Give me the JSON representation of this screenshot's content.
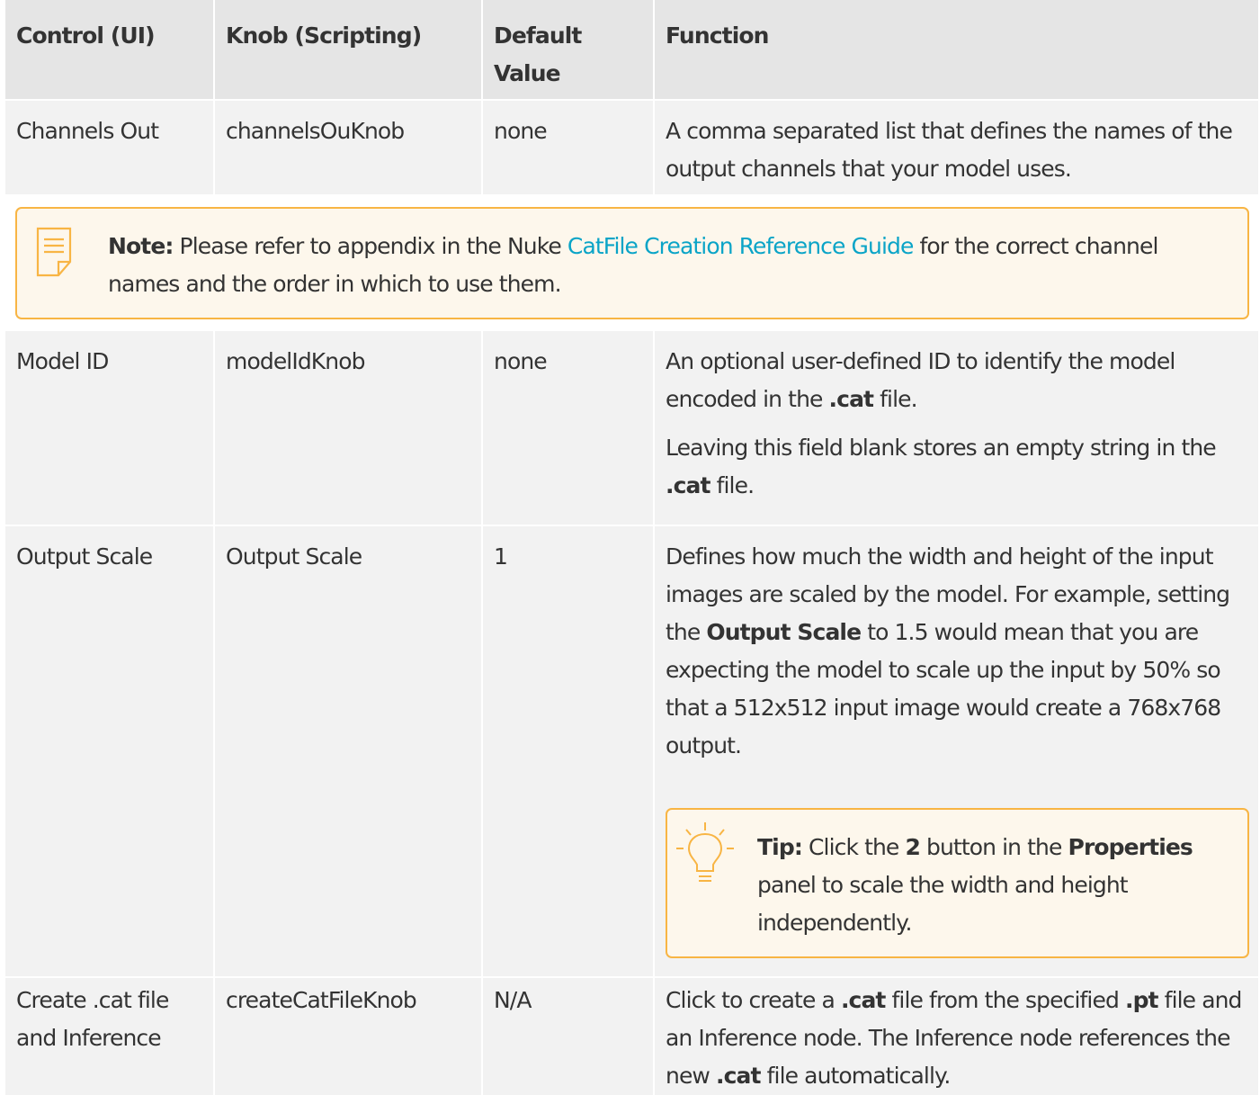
{
  "headers": [
    "Control (UI)",
    "Knob (Scripting)",
    "Default Value",
    "Function"
  ],
  "default_header_line1": "Default",
  "default_header_line2": "Value",
  "rows": [
    {
      "control": "Channels Out",
      "knob": "channelsOuKnob",
      "default": "none",
      "function": "A comma separated list that defines the names of the output channels that your model uses."
    },
    {
      "control": "Model ID",
      "knob": "modelIdKnob",
      "default": "none",
      "function_p1_a": "An optional user-defined ID to identify the model encoded in the ",
      "function_p1_b": ".cat",
      "function_p1_c": " file.",
      "function_p2_a": "Leaving this field blank stores an empty string in the ",
      "function_p2_b": ".cat",
      "function_p2_c": " file."
    },
    {
      "control": "Output Scale",
      "knob": "Output Scale",
      "default": "1",
      "function_a": "Defines how much the width and height of the input images are scaled by the model. For example, setting the ",
      "function_b": "Output Scale",
      "function_c": " to 1.5 would mean that you are expecting the model to scale up the input by 50% so that a 512x512 input image would create a 768x768 output."
    },
    {
      "control": "Create .cat file and Inference",
      "knob": "createCatFileKnob",
      "default": "N/A",
      "function_a": "Click to create a ",
      "function_b": ".cat",
      "function_c": " file from the specified ",
      "function_d": ".pt",
      "function_e": " file and an Inference node. The Inference node references the new ",
      "function_f": ".cat",
      "function_g": " file automatically."
    }
  ],
  "note": {
    "label": "Note:",
    "text_a": " Please refer to appendix in the Nuke ",
    "link": "CatFile Creation Reference Guide",
    "text_b": " for the correct channel names and the order in which to use them."
  },
  "tip": {
    "label": "Tip:",
    "text_a": " Click the ",
    "bold_1": "2",
    "text_b": " button in the ",
    "bold_2": "Properties",
    "text_c": " panel to scale the width and height independently."
  },
  "colors": {
    "header_bg": "#e5e5e5",
    "row_bg": "#f2f2f2",
    "callout_border": "#f8b544",
    "callout_bg": "#fdf7ec",
    "link": "#0aa4c7",
    "icon": "#f8b544"
  },
  "icons": [
    "note-icon",
    "lightbulb-icon"
  ]
}
